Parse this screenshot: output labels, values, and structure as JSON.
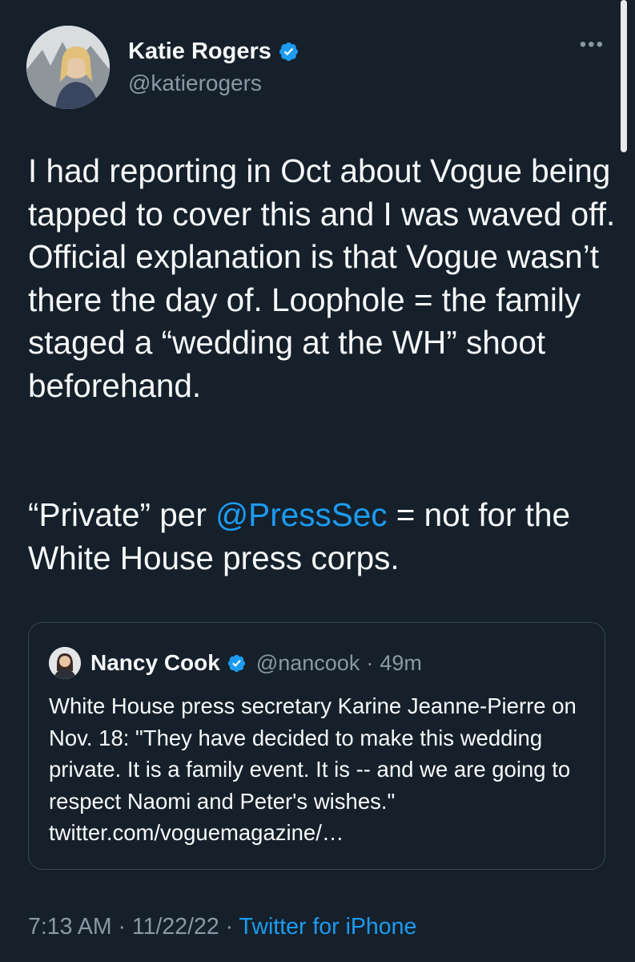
{
  "tweet": {
    "author": {
      "display_name": "Katie Rogers",
      "handle": "@katierogers",
      "verified": true
    },
    "more_icon": "more-horizontal-icon",
    "text_paragraph_1": "I had reporting in Oct about Vogue being tapped to cover this and I was waved off. Official explanation is that Vogue wasn’t there the day of. Loophole = the family staged a “wedding at the WH” shoot beforehand.",
    "text_paragraph_2": {
      "before": "“Private” per ",
      "mention": "@PressSec",
      "after": " = not for the White House press corps."
    },
    "quoted": {
      "display_name": "Nancy Cook",
      "handle": "@nancook",
      "separator": "·",
      "time": "49m",
      "verified": true,
      "text": "White House press secretary Karine Jeanne-Pierre on Nov. 18: \"They have decided to make this wedding private. It is a family event. It is -- and we are going to respect Naomi and Peter's wishes.\" twitter.com/voguemagazine/…"
    },
    "footer": {
      "time": "7:13 AM",
      "separator": " · ",
      "date": "11/22/22",
      "source": "Twitter for iPhone"
    }
  },
  "colors": {
    "background": "#15202b",
    "text": "#f7f9f9",
    "secondary": "#8b98a5",
    "accent": "#1d9bf0",
    "border": "#38444d"
  }
}
